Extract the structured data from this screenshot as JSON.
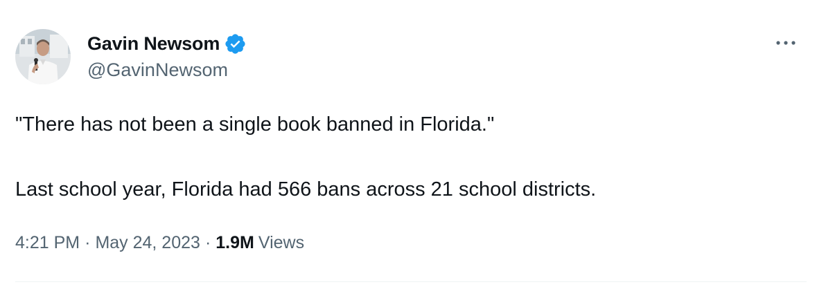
{
  "author": {
    "display_name": "Gavin Newsom",
    "handle": "@GavinNewsom",
    "verified_icon": "verified-badge-icon",
    "verified_color": "#1d9bf0"
  },
  "tweet": {
    "line1": "\"There has not been a single book banned in Florida.\"",
    "line2": "Last school year, Florida had 566 bans across 21 school districts."
  },
  "meta": {
    "time": "4:21 PM",
    "separator": "·",
    "date": "May 24, 2023",
    "views_count": "1.9M",
    "views_label": "Views"
  },
  "icons": {
    "more": "more-horizontal-icon"
  },
  "colors": {
    "text_primary": "#0f1419",
    "text_secondary": "#536471",
    "divider": "#eff3f4"
  }
}
